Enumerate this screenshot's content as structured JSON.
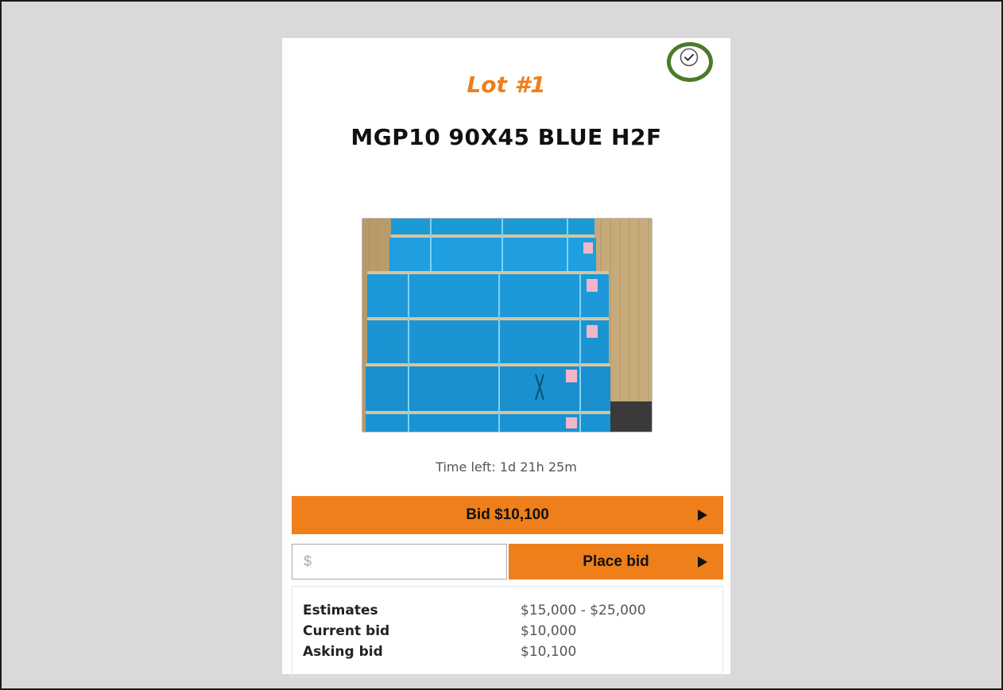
{
  "lot": {
    "label": "Lot #1",
    "title": "MGP10 90X45 BLUE H2F",
    "time_left": "Time left: 1d 21h 25m",
    "watch_icon": "check-circle-icon"
  },
  "actions": {
    "quick_bid_label": "Bid $10,100",
    "bid_input_placeholder": "$",
    "bid_input_value": "",
    "place_bid_label": "Place bid",
    "arrow_icon": "play-arrow-icon"
  },
  "details": [
    {
      "key": "Estimates",
      "value": "$15,000 - $25,000"
    },
    {
      "key": "Current bid",
      "value": "$10,000"
    },
    {
      "key": "Asking bid",
      "value": "$10,100"
    }
  ],
  "colors": {
    "accent": "#ef7f1a",
    "highlight_ring": "#4a7a2a",
    "background": "#d9d9d9"
  }
}
